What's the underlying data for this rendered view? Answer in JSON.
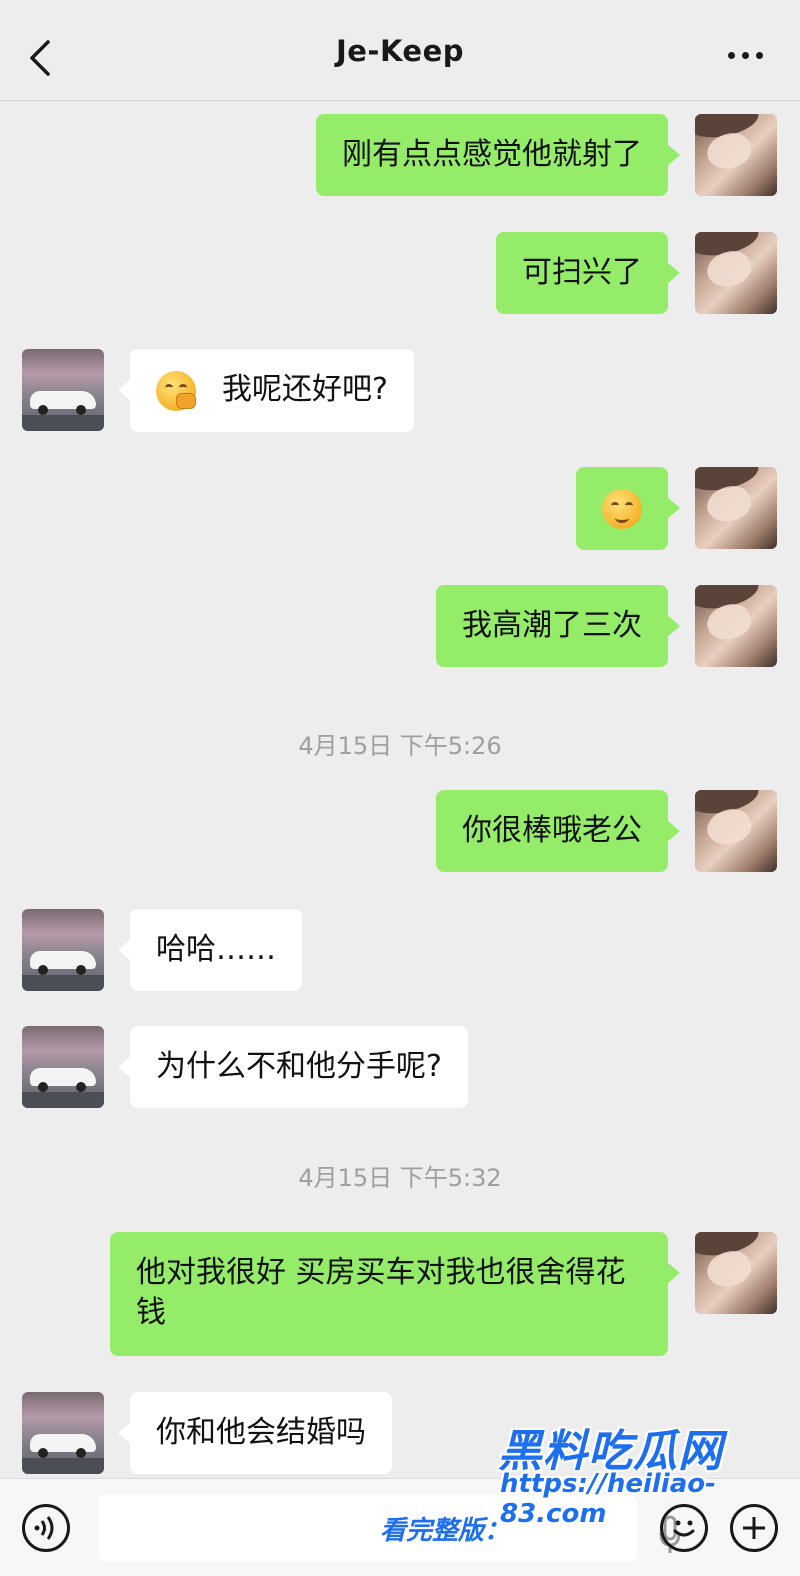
{
  "header": {
    "title": "Je-Keep"
  },
  "messages": [
    {
      "side": "me",
      "text": "刚有点点感觉他就射了"
    },
    {
      "side": "me",
      "text": "可扫兴了"
    },
    {
      "side": "them",
      "text": "我呢还好吧?",
      "emoji": "hand-over-mouth-emoji"
    },
    {
      "side": "me",
      "emoji": "smiling-eyes-emoji"
    },
    {
      "side": "me",
      "text": "我高潮了三次"
    },
    {
      "side": "me",
      "text": "你很棒哦老公"
    },
    {
      "side": "them",
      "text": "哈哈……"
    },
    {
      "side": "them",
      "text": "为什么不和他分手呢?"
    },
    {
      "side": "me",
      "text": "他对我很好  买房买车对我也很舍得花钱"
    },
    {
      "side": "them",
      "text": "你和他会结婚吗"
    }
  ],
  "timestamps": [
    "4月15日 下午5:26",
    "4月15日 下午5:32"
  ],
  "watermark": {
    "logo": "黑料吃瓜网",
    "url": "https://heiliao-83.com",
    "label": "看完整版："
  },
  "colors": {
    "my_bubble": "#95ec69",
    "their_bubble": "#ffffff",
    "background": "#ededed",
    "watermark": "#1e6ff0"
  }
}
